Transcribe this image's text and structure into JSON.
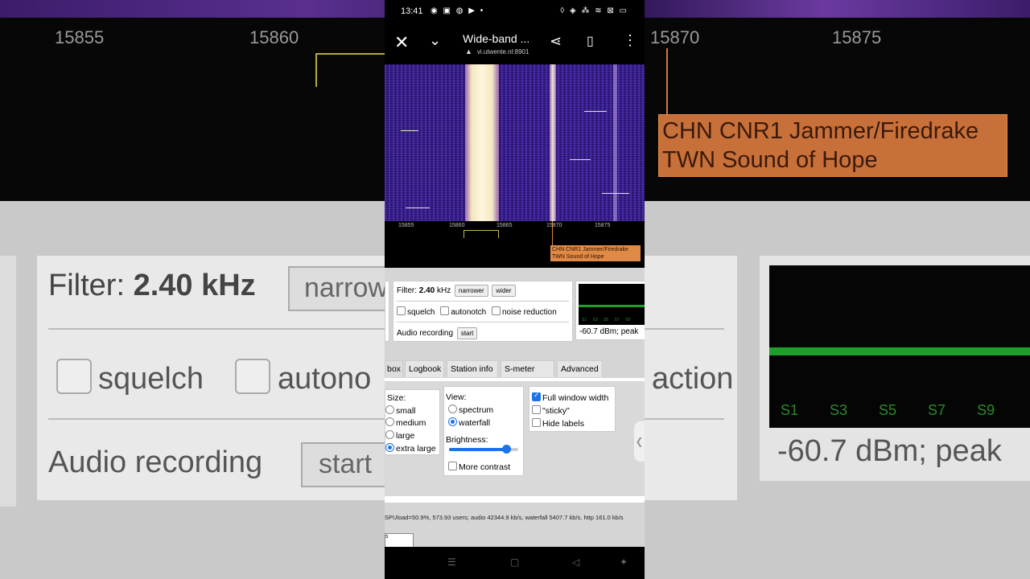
{
  "status": {
    "time": "13:41",
    "apps": "◉ ▣ ◍ ▶ •",
    "right": "◊ ◈ ⁂ ≋ ⊠ ▭"
  },
  "browser": {
    "title": "Wide-band ...",
    "url": "vi.utwente.nl:8901"
  },
  "spectrum": {
    "scale_labels": [
      "15855",
      "15860",
      "15865",
      "15870",
      "15875"
    ],
    "station_label": "CHN CNR1 Jammer/Firedrake TWN Sound of Hope"
  },
  "controls": {
    "filter_label": "Filter:",
    "filter_value": "2.40",
    "filter_unit": "kHz",
    "narrower": "narrower",
    "wider": "wider",
    "squelch": "squelch",
    "autonotch": "autonotch",
    "noise_reduction": "noise reduction",
    "audio_recording": "Audio recording",
    "start": "start"
  },
  "smeter": {
    "ticks": "S1 S3 S5 S7 S9",
    "reading": "-60.7 dBm; peak"
  },
  "tabs": [
    "box",
    "Logbook",
    "Station info",
    "S-meter plot",
    "Advanced"
  ],
  "size": {
    "label": "Size:",
    "options": [
      "small",
      "medium",
      "large",
      "extra large"
    ],
    "selected": "extra large"
  },
  "view": {
    "label": "View:",
    "options": [
      "spectrum",
      "waterfall"
    ],
    "selected": "waterfall",
    "brightness_label": "Brightness:",
    "brightness_fraction": 0.82,
    "more_contrast": "More contrast"
  },
  "window": {
    "full_width": "Full window width",
    "sticky": "\"sticky\"",
    "hide_labels": "Hide labels"
  },
  "status_line": "SPUload=50.9%, 573.93 users; audio 42344.9 kb/s, waterfall 5407.7 kb/s, http 161.0 kb/s",
  "input_value": "s",
  "background": {
    "scale_labels": [
      "15855",
      "15860",
      "15870",
      "15875"
    ],
    "station_label": "CHN CNR1 Jammer/Firedrake TWN Sound of Hope",
    "filter_text": "Filter:",
    "filter_value": "2.40 kHz",
    "narrow_text": "narrow",
    "squelch": "squelch",
    "autono": "autono",
    "action": "action",
    "audio_recording": "Audio recording",
    "start": "start",
    "smeter_ticks": "S1 S3 S5 S7 S9",
    "reading": "-60.7 dBm; peak"
  }
}
